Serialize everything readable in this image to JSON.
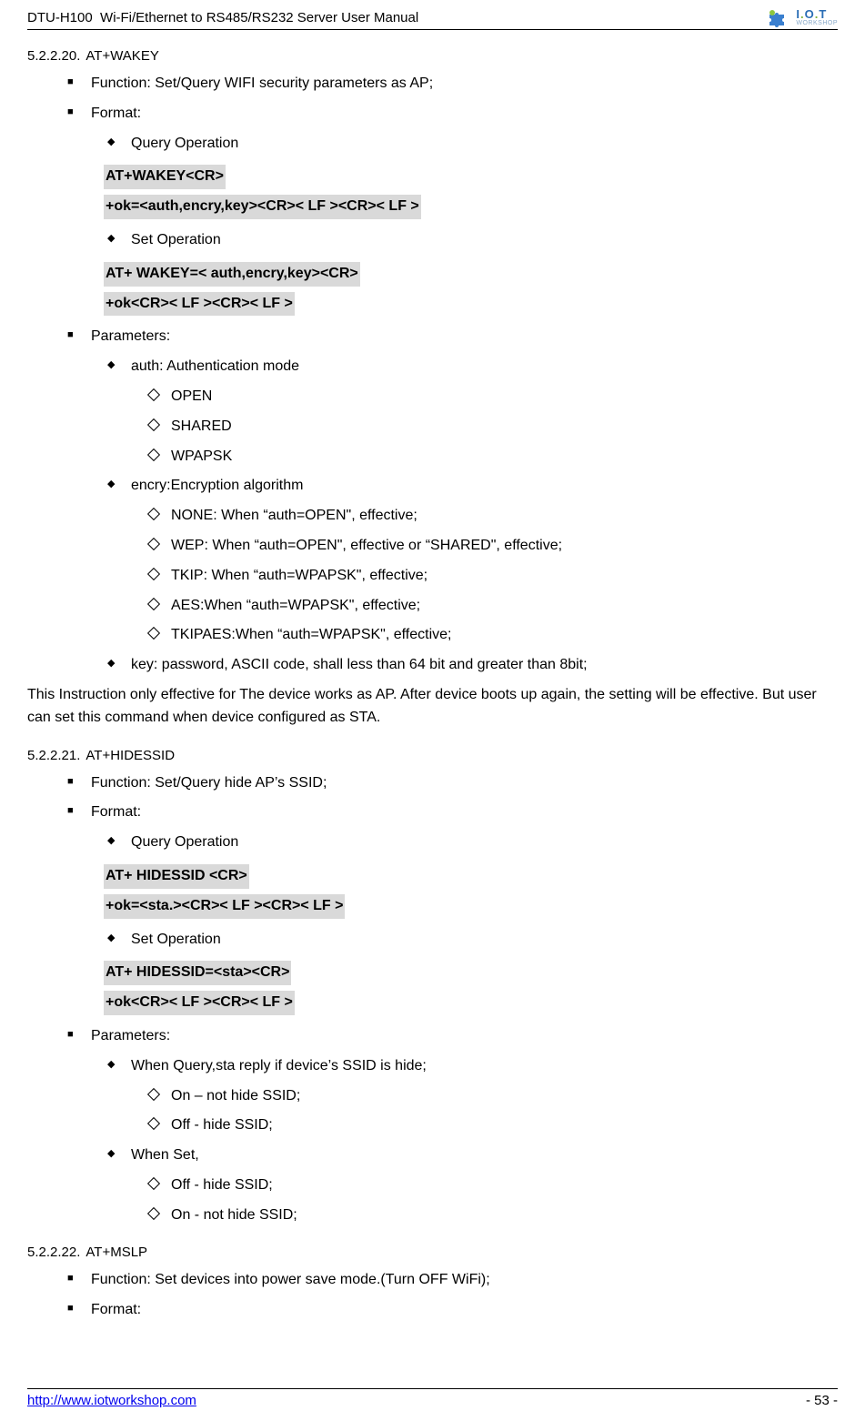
{
  "header": {
    "product": "DTU-H100",
    "title": "Wi-Fi/Ethernet to RS485/RS232  Server User Manual",
    "logo_main": "I.O.T",
    "logo_sub": "WORKSHOP"
  },
  "s1": {
    "num": "5.2.2.20.",
    "cmd": "AT+WAKEY",
    "function": "Function: Set/Query WIFI security parameters as AP;",
    "format": "Format:",
    "query": "Query Operation",
    "code_q1": "AT+WAKEY<CR>",
    "code_q2": "+ok=<auth,encry,key><CR>< LF ><CR>< LF >",
    "set": "Set Operation",
    "code_s1": "AT+ WAKEY=< auth,encry,key><CR>",
    "code_s2": "+ok<CR>< LF ><CR>< LF >",
    "params": "Parameters:",
    "p_auth": "auth: Authentication mode",
    "auth1": "OPEN",
    "auth2": "SHARED",
    "auth3": "WPAPSK",
    "p_encry": "encry:Encryption algorithm",
    "enc1": "NONE: When “auth=OPEN\", effective;",
    "enc2": "WEP: When “auth=OPEN\", effective or “SHARED\", effective;",
    "enc3": "TKIP: When “auth=WPAPSK\", effective;",
    "enc4": "AES:When “auth=WPAPSK\", effective;",
    "enc5": "TKIPAES:When “auth=WPAPSK\", effective;",
    "p_key": "key: password, ASCII code, shall less than 64 bit and greater than 8bit;",
    "note": "This Instruction only effective for The device works as AP. After device boots up again, the setting will be effective. But user can set this command when device configured as STA."
  },
  "s2": {
    "num": "5.2.2.21.",
    "cmd": "AT+HIDESSID",
    "function": "Function: Set/Query hide AP’s SSID;",
    "format": "Format:",
    "query": "Query Operation",
    "code_q1": "AT+ HIDESSID <CR>",
    "code_q2": "+ok=<sta.><CR>< LF ><CR>< LF >",
    "set": "Set Operation",
    "code_s1": "AT+ HIDESSID=<sta><CR>",
    "code_s2": "+ok<CR>< LF ><CR>< LF >",
    "params": "Parameters:",
    "p_query": "When Query,sta reply if device’s SSID is hide;",
    "q1": "On – not hide SSID;",
    "q2": "Off -  hide SSID;",
    "p_set": "When Set,",
    "set1": "Off - hide SSID;",
    "set2": "On - not hide SSID;"
  },
  "s3": {
    "num": "5.2.2.22.",
    "cmd": "AT+MSLP",
    "function": "Function: Set devices into power save mode.(Turn OFF WiFi);",
    "format": "Format:"
  },
  "footer": {
    "url": "http://www.iotworkshop.com",
    "page": "- 53 -"
  }
}
